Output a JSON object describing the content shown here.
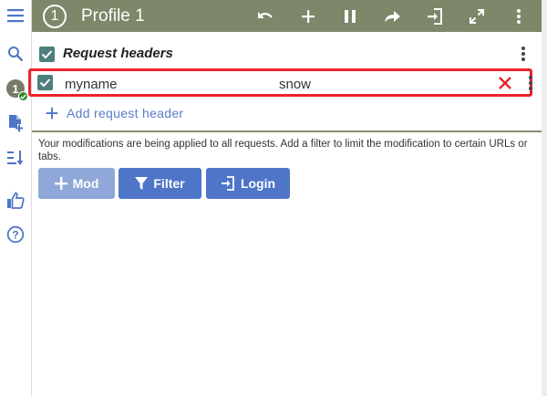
{
  "topbar": {
    "profile_number": "1",
    "profile_title": "Profile 1",
    "icons": [
      "undo-icon",
      "add-icon",
      "pause-icon",
      "share-icon",
      "import-icon",
      "expand-icon",
      "more-vert-icon"
    ]
  },
  "sidebar": {
    "items": [
      {
        "icon": "menu-icon"
      },
      {
        "icon": "search-icon"
      },
      {
        "icon": "profile-badge",
        "label": "1"
      },
      {
        "icon": "add-file-icon"
      },
      {
        "icon": "sort-icon"
      },
      {
        "icon": "thumbs-up-icon"
      },
      {
        "icon": "help-icon"
      }
    ]
  },
  "request_headers": {
    "title": "Request headers",
    "enabled": true,
    "rows": [
      {
        "enabled": true,
        "name": "myname",
        "value": "snow"
      }
    ],
    "add_label": "Add request header"
  },
  "info_text": "Your modifications are being applied to all requests. Add a filter to limit the modification to certain URLs or tabs.",
  "buttons": {
    "mod": "Mod",
    "filter": "Filter",
    "login": "Login"
  },
  "colors": {
    "topbar": "#7d8769",
    "checkbox": "#4d7f7e",
    "accent": "#4e75c8",
    "highlight": "#e8242a"
  }
}
